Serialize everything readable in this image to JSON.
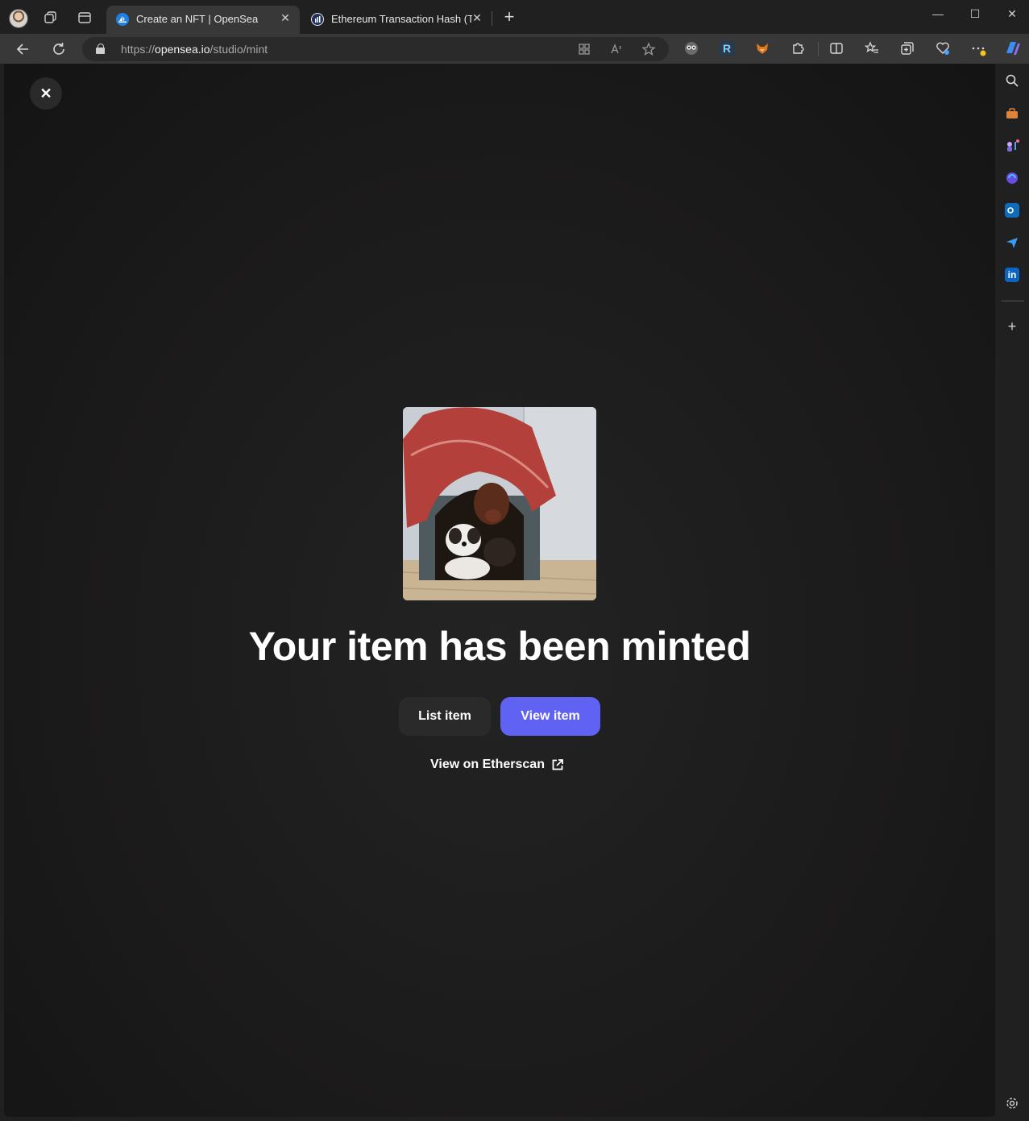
{
  "browser": {
    "tabs": [
      {
        "title": "Create an NFT | OpenSea",
        "active": true
      },
      {
        "title": "Ethereum Transaction Hash (Txha",
        "active": false
      }
    ],
    "url": {
      "scheme": "https://",
      "host": "opensea.io",
      "path": "/studio/mint"
    },
    "window_controls": {
      "minimize": "—",
      "maximize": "☐",
      "close": "✕"
    },
    "extensions": [
      "owl-icon",
      "r-extension-icon",
      "fox-wallet-icon",
      "puzzle-icon"
    ],
    "extension_r_label": "R",
    "sidebar": {
      "linkedin_label": "in",
      "add_label": "+"
    }
  },
  "modal": {
    "close_label": "✕",
    "headline": "Your item has been minted",
    "list_button": "List item",
    "view_button": "View item",
    "etherscan_link": "View on Etherscan",
    "image_alt": "Two dogs inside a red-roofed dog house"
  },
  "colors": {
    "accent": "#5f62f2",
    "page_bg": "#1c1b1b",
    "secondary_button": "#2a2a2a"
  }
}
